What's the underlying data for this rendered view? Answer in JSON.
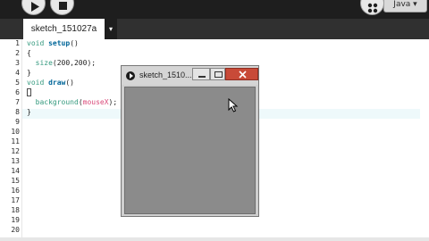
{
  "toolbar": {
    "play_icon": "play-icon",
    "stop_icon": "stop-icon",
    "mode_icon": "mode-icon",
    "mode_label": "Java ▾"
  },
  "tabs": [
    {
      "label": "sketch_151027a"
    }
  ],
  "tab_menu_label": "▾",
  "editor": {
    "line_numbers": [
      "1",
      "2",
      "3",
      "4",
      "5",
      "6",
      "7",
      "8",
      "9",
      "10",
      "11",
      "12",
      "13",
      "14",
      "15",
      "16",
      "17",
      "18",
      "19",
      "20"
    ],
    "lines": [
      "void setup()",
      "{",
      "  size(200,200);",
      "}",
      "void draw()",
      "{",
      "  background(mouseX);",
      "}"
    ]
  },
  "sketch_window": {
    "title": "sketch_1510...",
    "controls": [
      "minimize",
      "maximize",
      "close"
    ],
    "canvas_color": "#8b8b8b"
  },
  "colors": {
    "toolbar_bg": "#1e1e1e",
    "tabbar_bg": "#303030",
    "keyword": "#33997e",
    "function": "#006699",
    "variable": "#d94a7a"
  }
}
